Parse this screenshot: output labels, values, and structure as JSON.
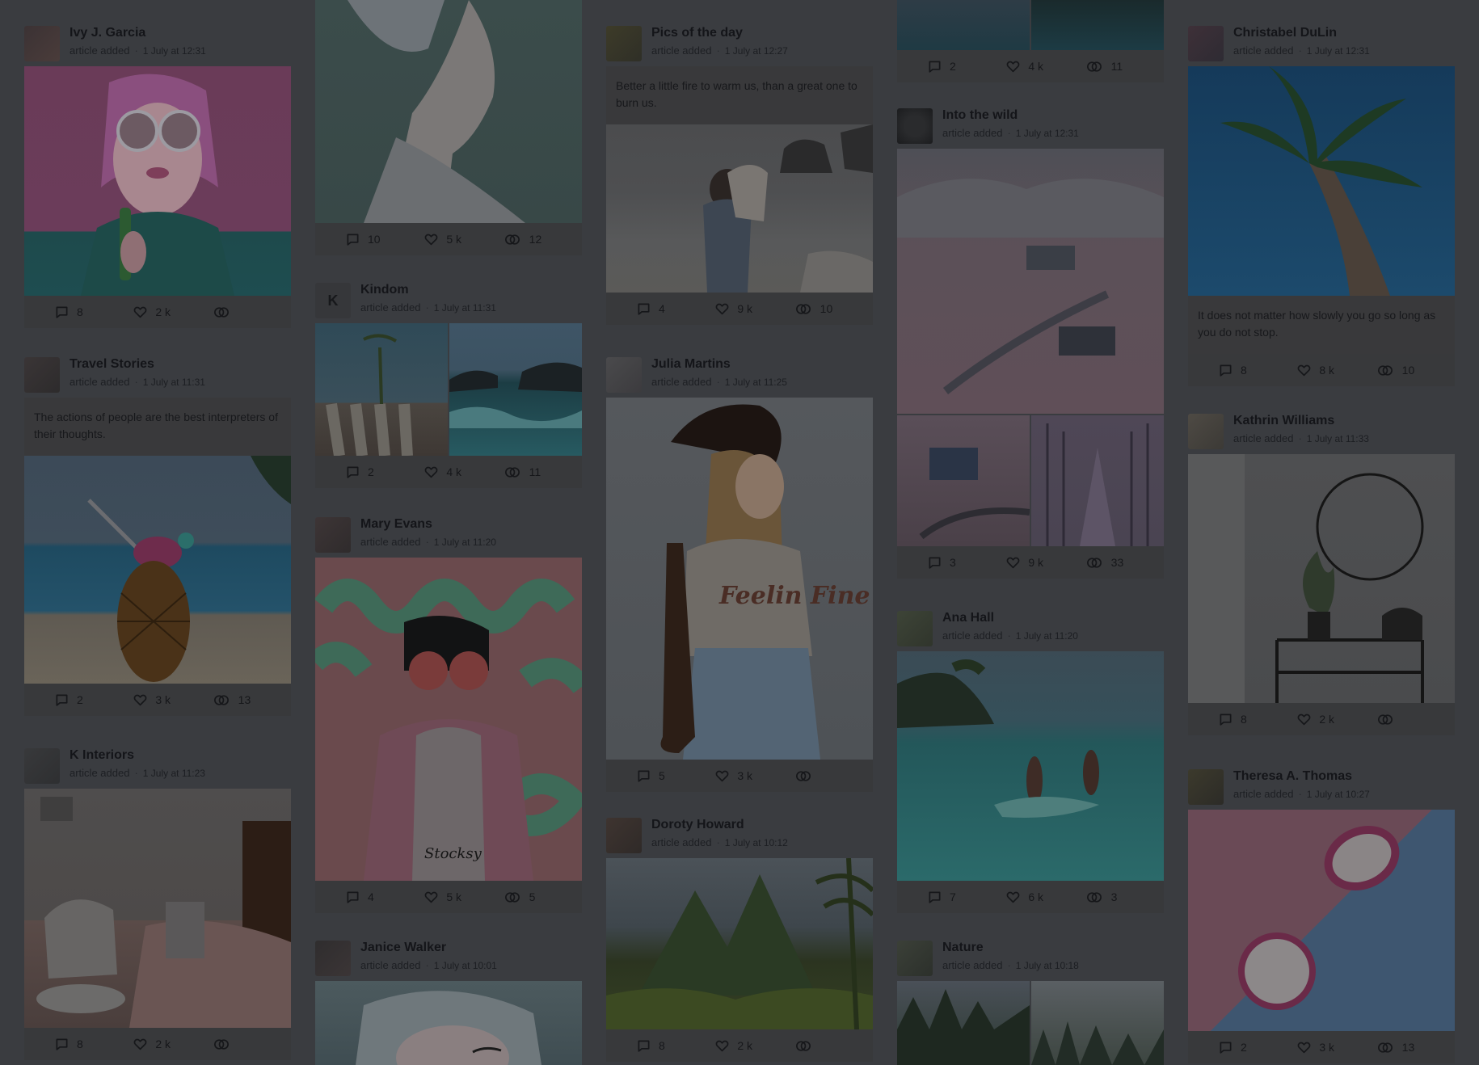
{
  "cards": {
    "ivy": {
      "author": "Ivy J. Garcia",
      "action": "article added",
      "time": "1 July at 12:31",
      "comments": "8",
      "likes": "2 k",
      "shares": ""
    },
    "travel": {
      "author": "Travel Stories",
      "action": "article added",
      "time": "1 July at 11:31",
      "quote": "The actions of people are the best interpreters of their thoughts.",
      "comments": "2",
      "likes": "3 k",
      "shares": "13"
    },
    "kinteriors": {
      "author": "K Interiors",
      "action": "article added",
      "time": "1 July at 11:23",
      "comments": "8",
      "likes": "2 k",
      "shares": ""
    },
    "portrait_top": {
      "comments": "10",
      "likes": "5 k",
      "shares": "12"
    },
    "kindom": {
      "author": "Kindom",
      "action": "article added",
      "time": "1 July at 11:31",
      "comments": "2",
      "likes": "4 k",
      "shares": "11"
    },
    "mary": {
      "author": "Mary Evans",
      "action": "article added",
      "time": "1 July at 11:20",
      "comments": "4",
      "likes": "5 k",
      "shares": "5",
      "stock_logo": "Stocksy"
    },
    "janice": {
      "author": "Janice Walker",
      "action": "article added",
      "time": "1 July at 10:01"
    },
    "pics": {
      "author": "Pics of the day",
      "action": "article added",
      "time": "1 July at 12:27",
      "quote": "Better a little fire to warm us, than a great one to burn us.",
      "comments": "4",
      "likes": "9 k",
      "shares": "10"
    },
    "julia": {
      "author": "Julia Martins",
      "action": "article added",
      "time": "1 July at 11:25",
      "comments": "5",
      "likes": "3 k",
      "shares": "",
      "shirt_text": "Feelin Fine"
    },
    "doroty": {
      "author": "Doroty Howard",
      "action": "article added",
      "time": "1 July at 10:12",
      "comments": "8",
      "likes": "2 k",
      "shares": ""
    },
    "lake_top": {
      "comments": "2",
      "likes": "4 k",
      "shares": "11"
    },
    "wild": {
      "author": "Into the wild",
      "action": "article added",
      "time": "1 July at 12:31",
      "comments": "3",
      "likes": "9 k",
      "shares": "33"
    },
    "ana": {
      "author": "Ana Hall",
      "action": "article added",
      "time": "1 July at 11:20",
      "comments": "7",
      "likes": "6 k",
      "shares": "3"
    },
    "nature": {
      "author": "Nature",
      "action": "article added",
      "time": "1 July at 10:18"
    },
    "christabel": {
      "author": "Christabel DuLin",
      "action": "article added",
      "time": "1 July at 12:31",
      "quote": "It does not matter how slowly you go so long as you do not stop.",
      "comments": "8",
      "likes": "8 k",
      "shares": "10"
    },
    "kathrin": {
      "author": "Kathrin Williams",
      "action": "article added",
      "time": "1 July at 11:33",
      "comments": "8",
      "likes": "2 k",
      "shares": ""
    },
    "theresa": {
      "author": "Theresa A. Thomas",
      "action": "article added",
      "time": "1 July at 10:27",
      "comments": "2",
      "likes": "3 k",
      "shares": "13"
    }
  },
  "colors": {
    "overlay_background": "#3a3c40",
    "panel": "#39393b",
    "text": "#141519"
  },
  "icons": {
    "comment": "comment-icon",
    "like": "heart-icon",
    "share": "share-rings-icon"
  }
}
